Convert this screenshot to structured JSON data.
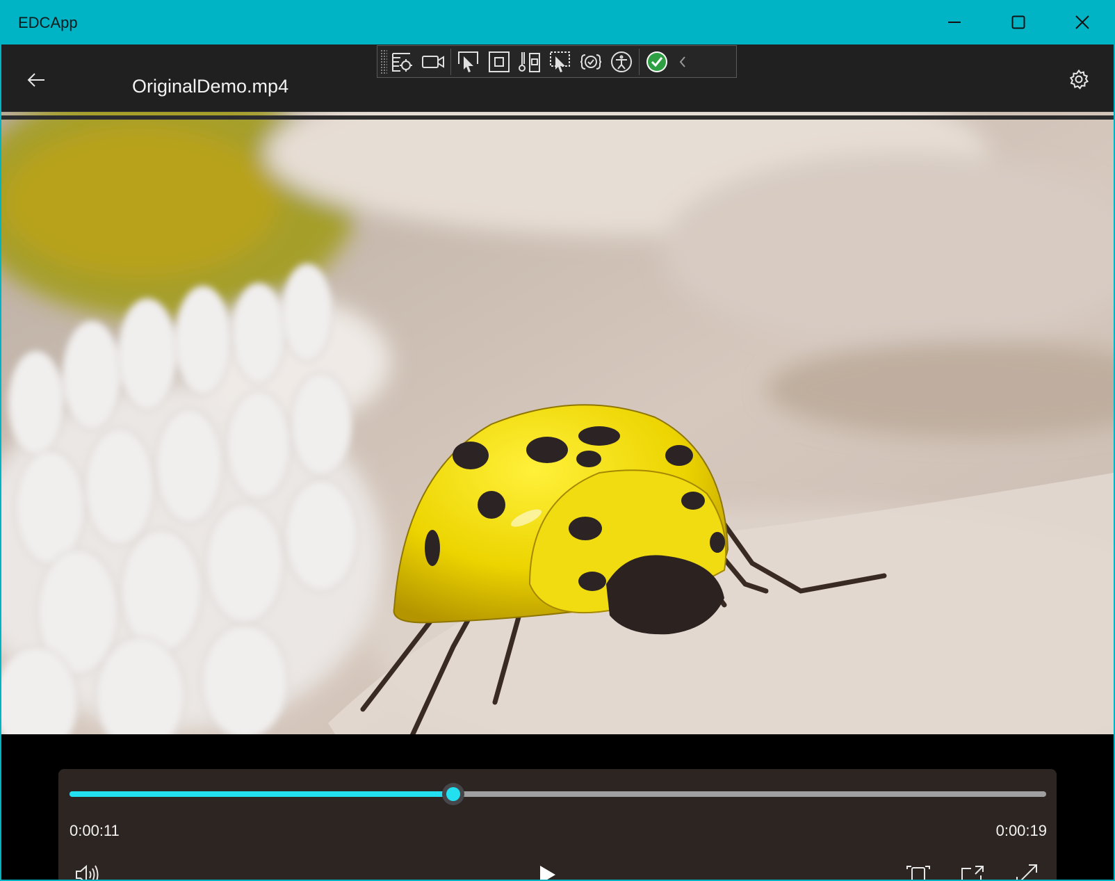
{
  "window": {
    "title": "EDCApp"
  },
  "header": {
    "file_name": "OriginalDemo.mp4"
  },
  "player": {
    "current_time": "0:00:11",
    "total_time": "0:00:19",
    "progress_fraction": 0.393,
    "accent_color": "#22e0f0"
  },
  "icons": {
    "titlebar": [
      "minimize-icon",
      "maximize-icon",
      "close-icon"
    ],
    "header": [
      "back-arrow-icon",
      "gear-icon"
    ],
    "dev_toolbar": [
      "live-visual-tree-icon",
      "record-video-icon",
      "select-element-icon",
      "display-layout-adorners-icon",
      "track-focus-icon",
      "select-in-tree-icon",
      "hot-reload-icon",
      "accessibility-icon",
      "hot-reload-status-icon",
      "collapse-chevron-icon"
    ],
    "controls": [
      "volume-icon",
      "play-icon",
      "aspect-ratio-icon",
      "cast-icon",
      "fullscreen-icon"
    ]
  }
}
